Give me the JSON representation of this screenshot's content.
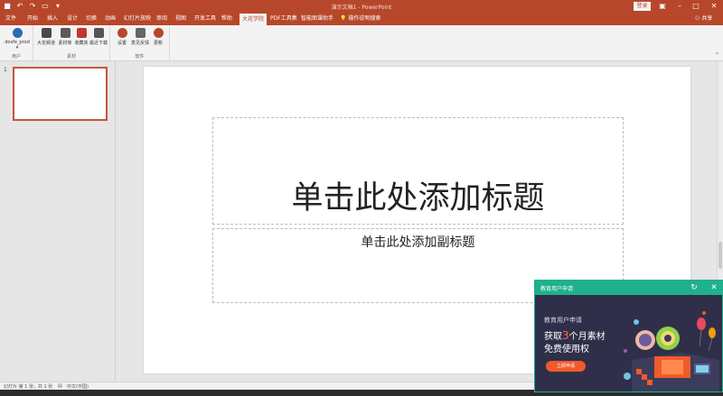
{
  "window": {
    "title": "演示文稿1 - PowerPoint",
    "login_label": "登录",
    "share_label": "共享"
  },
  "ribbon": {
    "tabs": [
      "文件",
      "开始",
      "插入",
      "设计",
      "切换",
      "动画",
      "幻灯片放映",
      "审阅",
      "视图",
      "开发工具",
      "帮助",
      "大花学院",
      "PDF工具集",
      "智能图课助手"
    ],
    "active_tab": "大花学院",
    "tell_me": "操作说明搜索",
    "groups": [
      {
        "label": "用户",
        "buttons": [
          "dosfe_prod"
        ]
      },
      {
        "label": "素材",
        "buttons": [
          "大花频道",
          "素材库",
          "收藏夹",
          "最近下载"
        ]
      },
      {
        "label": "软件",
        "buttons": [
          "设置",
          "意见反馈",
          "更新"
        ]
      }
    ],
    "user_caret": "▾"
  },
  "thumbnails": [
    {
      "number": "1"
    }
  ],
  "slide": {
    "title_placeholder": "单击此处添加标题",
    "subtitle_placeholder": "单击此处添加副标题"
  },
  "statusbar": {
    "slide_info": "幻灯片 第 1 张，共 1 张",
    "language": "中文(中国)"
  },
  "popup": {
    "header": "教育用户申请",
    "subtitle": "教育用户申请",
    "headline_pre": "获取",
    "headline_num": "3",
    "headline_post": "个月素材",
    "headline2": "免费使用权",
    "button": "立即申请"
  },
  "colors": {
    "accent": "#b7472a",
    "popup_header": "#1fb08c",
    "popup_bg": "#2f2f4a",
    "popup_button": "#f15a2b"
  }
}
